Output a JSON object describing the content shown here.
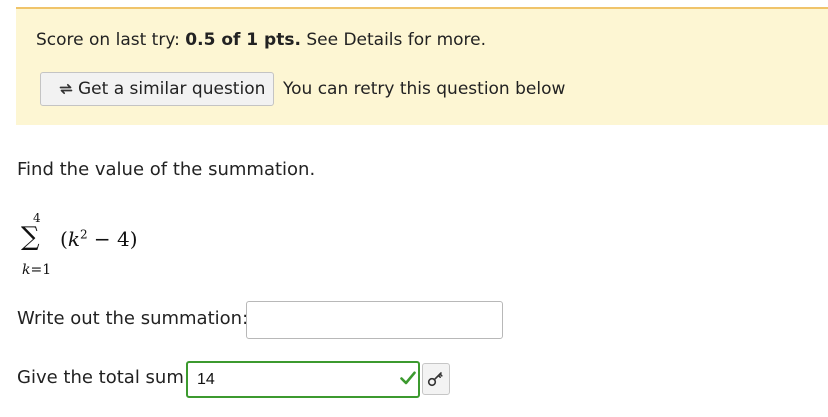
{
  "banner": {
    "score_prefix": "Score on last try:",
    "score_value": "0.5 of 1 pts.",
    "score_suffix": "See Details for more.",
    "similar_button_label": "Get a similar question",
    "retry_note": "You can retry this question below"
  },
  "question": {
    "prompt": "Find the value of the summation.",
    "summation": {
      "upper": "4",
      "symbol": "∑",
      "index_var": "k",
      "lower_value": "=1",
      "open": "(",
      "var": "k",
      "exponent": "2",
      "rest": " − 4)"
    },
    "write_label": "Write out the summation:",
    "write_value": "",
    "sum_label": "Give the total sum:",
    "sum_value": "14"
  },
  "colors": {
    "banner_bg": "#fdf6d3",
    "banner_border": "#f0c46a",
    "correct_green": "#3c9a2f"
  },
  "icons": {
    "similar": "retry-arrows-icon",
    "correct": "check-icon",
    "key": "key-icon"
  }
}
